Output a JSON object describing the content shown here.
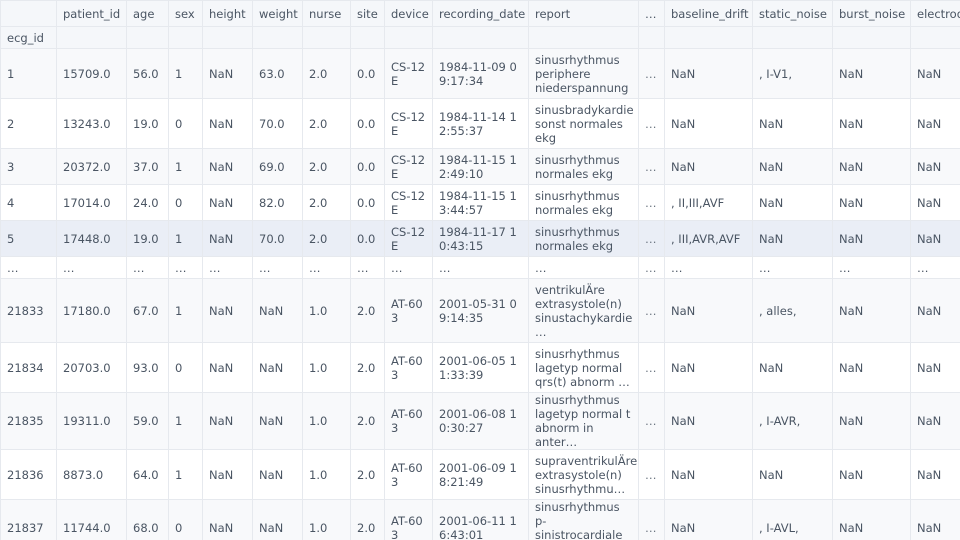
{
  "columns": [
    "patient_id",
    "age",
    "sex",
    "height",
    "weight",
    "nurse",
    "site",
    "device",
    "recording_date",
    "report",
    "…",
    "baseline_drift",
    "static_noise",
    "burst_noise",
    "electrod"
  ],
  "index_name": "ecg_id",
  "ellipsis": "…",
  "rows": [
    {
      "id": "1",
      "cells": [
        "15709.0",
        "56.0",
        "1",
        "NaN",
        "63.0",
        "2.0",
        "0.0",
        "CS-12 E",
        "1984-11-09 09:17:34",
        "sinusrhythmus periphere niederspannung",
        "…",
        "NaN",
        ", I-V1,",
        "NaN",
        "NaN"
      ]
    },
    {
      "id": "2",
      "cells": [
        "13243.0",
        "19.0",
        "0",
        "NaN",
        "70.0",
        "2.0",
        "0.0",
        "CS-12 E",
        "1984-11-14 12:55:37",
        "sinusbradykardie sonst normales ekg",
        "…",
        "NaN",
        "NaN",
        "NaN",
        "NaN"
      ]
    },
    {
      "id": "3",
      "cells": [
        "20372.0",
        "37.0",
        "1",
        "NaN",
        "69.0",
        "2.0",
        "0.0",
        "CS-12 E",
        "1984-11-15 12:49:10",
        "sinusrhythmus normales ekg",
        "…",
        "NaN",
        "NaN",
        "NaN",
        "NaN"
      ]
    },
    {
      "id": "4",
      "cells": [
        "17014.0",
        "24.0",
        "0",
        "NaN",
        "82.0",
        "2.0",
        "0.0",
        "CS-12 E",
        "1984-11-15 13:44:57",
        "sinusrhythmus normales ekg",
        "…",
        ", II,III,AVF",
        "NaN",
        "NaN",
        "NaN"
      ]
    },
    {
      "id": "5",
      "cells": [
        "17448.0",
        "19.0",
        "1",
        "NaN",
        "70.0",
        "2.0",
        "0.0",
        "CS-12 E",
        "1984-11-17 10:43:15",
        "sinusrhythmus normales ekg",
        "…",
        ", III,AVR,AVF",
        "NaN",
        "NaN",
        "NaN"
      ]
    },
    {
      "id": "…",
      "cells": [
        "…",
        "…",
        "…",
        "…",
        "…",
        "…",
        "…",
        "…",
        "…",
        "…",
        "…",
        "…",
        "…",
        "…",
        "…"
      ]
    },
    {
      "id": "21833",
      "cells": [
        "17180.0",
        "67.0",
        "1",
        "NaN",
        "NaN",
        "1.0",
        "2.0",
        "AT-60 3",
        "2001-05-31 09:14:35",
        "ventrikulÄre extrasystole(n) sinustachykardie …",
        "…",
        "NaN",
        ", alles,",
        "NaN",
        "NaN"
      ]
    },
    {
      "id": "21834",
      "cells": [
        "20703.0",
        "93.0",
        "0",
        "NaN",
        "NaN",
        "1.0",
        "2.0",
        "AT-60 3",
        "2001-06-05 11:33:39",
        "sinusrhythmus lagetyp normal qrs(t) abnorm …",
        "…",
        "NaN",
        "NaN",
        "NaN",
        "NaN"
      ]
    },
    {
      "id": "21835",
      "cells": [
        "19311.0",
        "59.0",
        "1",
        "NaN",
        "NaN",
        "1.0",
        "2.0",
        "AT-60 3",
        "2001-06-08 10:30:27",
        "sinusrhythmus lagetyp normal t abnorm in anter…",
        "…",
        "NaN",
        ", I-AVR,",
        "NaN",
        "NaN"
      ]
    },
    {
      "id": "21836",
      "cells": [
        "8873.0",
        "64.0",
        "1",
        "NaN",
        "NaN",
        "1.0",
        "2.0",
        "AT-60 3",
        "2001-06-09 18:21:49",
        "supraventrikulÄre extrasystole(n) sinusrhythmu…",
        "…",
        "NaN",
        "NaN",
        "NaN",
        "NaN"
      ]
    },
    {
      "id": "21837",
      "cells": [
        "11744.0",
        "68.0",
        "0",
        "NaN",
        "NaN",
        "1.0",
        "2.0",
        "AT-60 3",
        "2001-06-11 16:43:01",
        "sinusrhythmus p-sinistrocardiale lagetyp norma…",
        "…",
        "NaN",
        ", I-AVL,",
        "NaN",
        "NaN"
      ]
    }
  ],
  "highlight_row_index": 4
}
